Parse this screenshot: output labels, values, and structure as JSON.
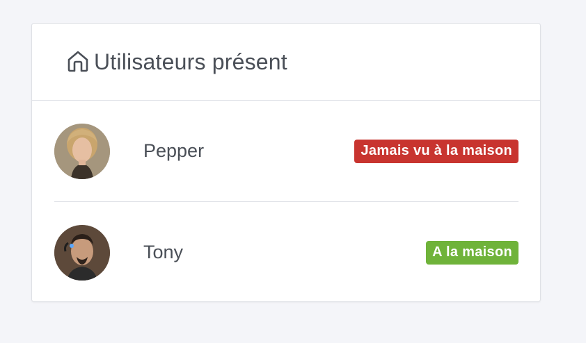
{
  "card": {
    "title": "Utilisateurs présent",
    "icon": "home-icon"
  },
  "users": [
    {
      "name": "Pepper",
      "status": "Jamais vu à la maison",
      "status_color": "#c8342f"
    },
    {
      "name": "Tony",
      "status": "A la maison",
      "status_color": "#6fb33a"
    }
  ],
  "colors": {
    "background": "#f4f5f9",
    "card": "#ffffff",
    "text": "#4a4f57"
  }
}
